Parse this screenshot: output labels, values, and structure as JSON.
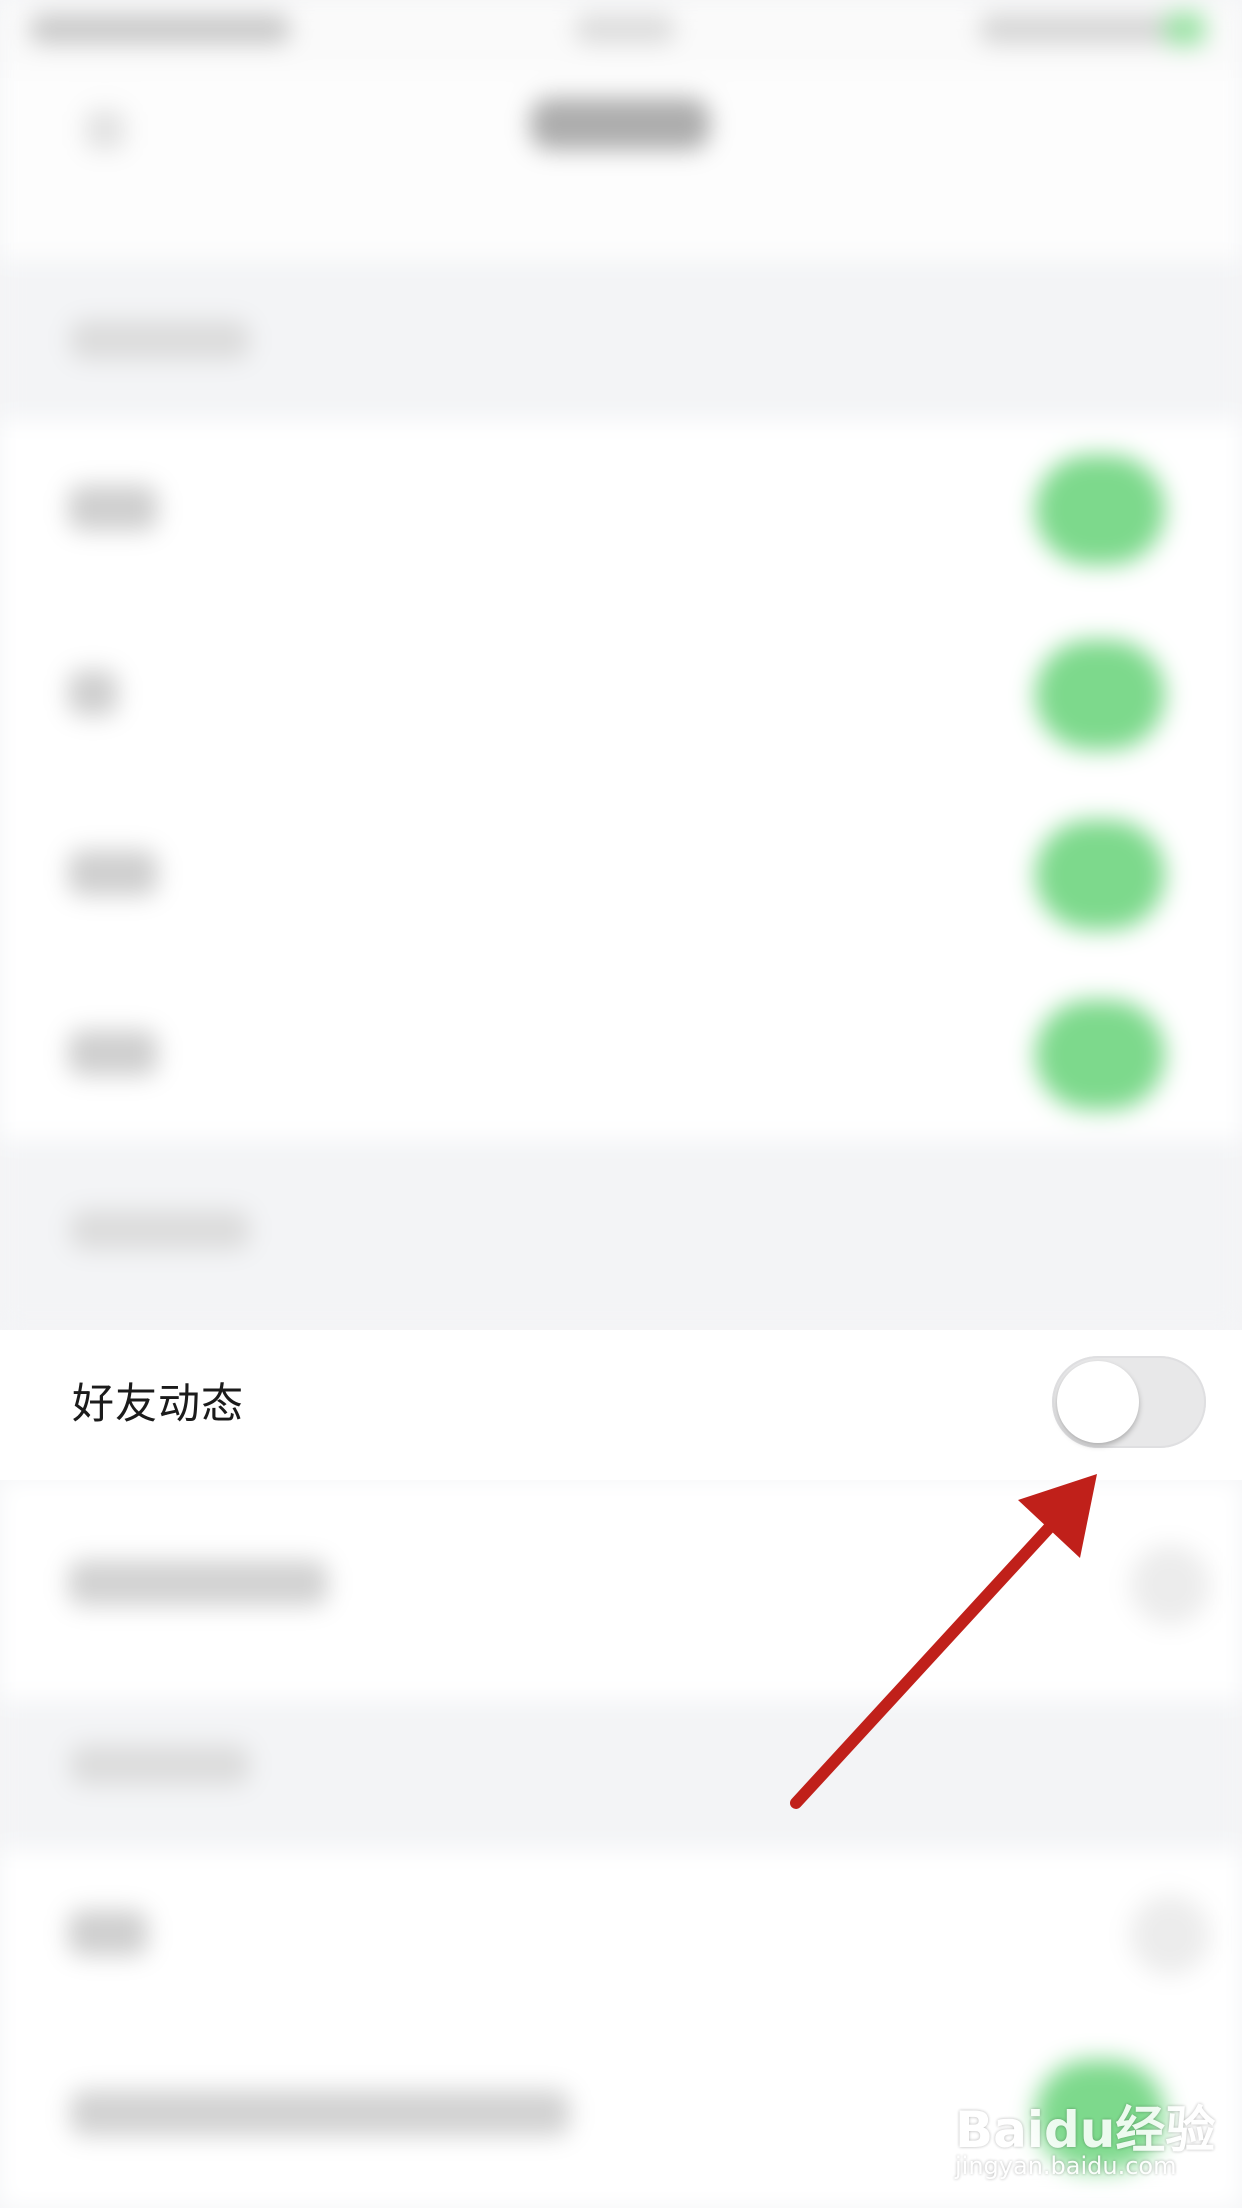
{
  "settings_row": {
    "label": "好友动态",
    "toggle_on": false
  },
  "colors": {
    "toggle_on_color": "#7dd98c",
    "toggle_off_track": "#e8e8e9",
    "annotation_arrow": "#c0201a"
  },
  "watermark": {
    "brand": "Baidu经验",
    "url": "jingyan.baidu.com"
  }
}
